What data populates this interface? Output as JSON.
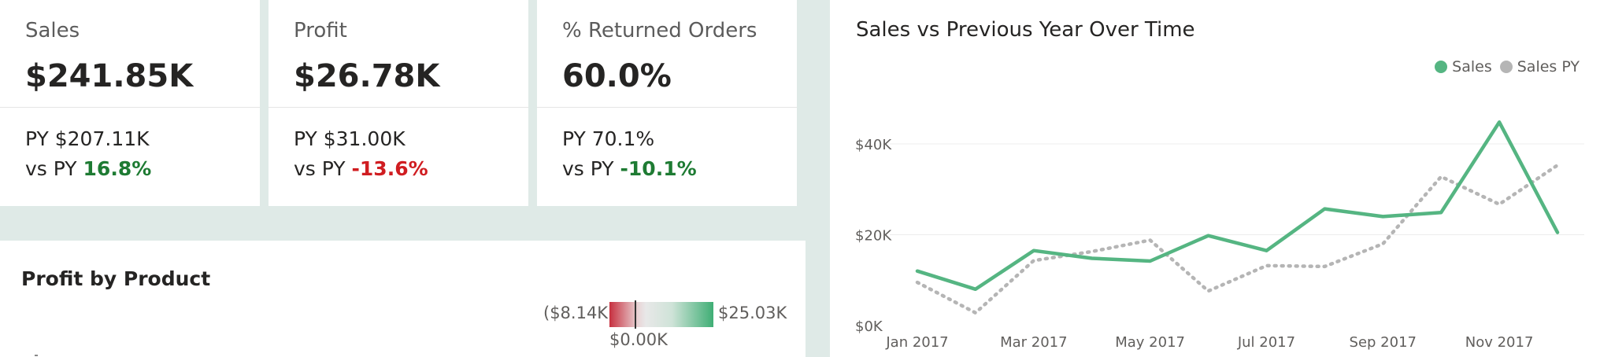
{
  "kpis": [
    {
      "title": "Sales",
      "value": "$241.85K",
      "py_label": "PY $207.11K",
      "vs_label": "vs PY",
      "vs_value": "16.8%",
      "vs_status": "pos"
    },
    {
      "title": "Profit",
      "value": "$26.78K",
      "py_label": "PY $31.00K",
      "vs_label": "vs PY",
      "vs_value": "-13.6%",
      "vs_status": "neg"
    },
    {
      "title": "% Returned Orders",
      "value": "60.0%",
      "py_label": "PY 70.1%",
      "vs_label": "vs PY",
      "vs_value": "-10.1%",
      "vs_status": "pos"
    }
  ],
  "profit_by_product": {
    "title": "Profit by Product",
    "scale_min": "($8.14K)",
    "scale_mid": "$0.00K",
    "scale_max": "$25.03K"
  },
  "colors": {
    "sales": "#55b582",
    "sales_py": "#b5b5b5",
    "positive": "#1e7b33",
    "negative": "#d01d21"
  },
  "chart_data": {
    "type": "line",
    "title": "Sales vs Previous Year Over Time",
    "x": [
      "Jan 2017",
      "Feb 2017",
      "Mar 2017",
      "Apr 2017",
      "May 2017",
      "Jun 2017",
      "Jul 2017",
      "Aug 2017",
      "Sep 2017",
      "Oct 2017",
      "Nov 2017",
      "Dec 2017"
    ],
    "x_tick_labels": [
      "Jan 2017",
      "Mar 2017",
      "May 2017",
      "Jul 2017",
      "Sep 2017",
      "Nov 2017"
    ],
    "y_tick_labels": [
      "$0K",
      "$20K",
      "$40K"
    ],
    "ylim": [
      0,
      40000
    ],
    "series": [
      {
        "name": "Sales",
        "values": [
          12000,
          8000,
          16500,
          14800,
          14200,
          19800,
          16500,
          25700,
          24000,
          24900,
          44800,
          20500
        ],
        "style": "solid"
      },
      {
        "name": "Sales PY",
        "values": [
          9500,
          2800,
          14300,
          16300,
          18800,
          7600,
          13200,
          13000,
          18000,
          32800,
          26700,
          35300
        ],
        "style": "dotted"
      }
    ],
    "legend": "top-right",
    "grid": true
  }
}
